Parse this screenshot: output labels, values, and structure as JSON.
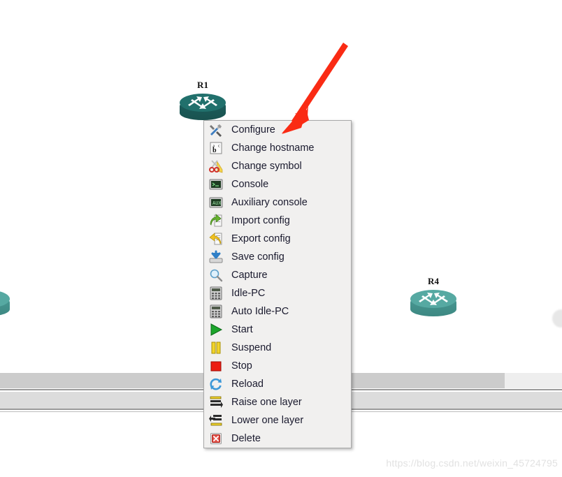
{
  "canvas": {
    "background_color": "#ffffff",
    "nodes": [
      {
        "id": "r1",
        "label": "R1",
        "style": "dark",
        "color": "#21706c"
      },
      {
        "id": "r4",
        "label": "R4",
        "style": "light",
        "color": "#56a9a2"
      },
      {
        "id": "partial-left",
        "label": "",
        "style": "dark",
        "color": "#3d8882"
      }
    ]
  },
  "context_menu": {
    "target_node": "R1",
    "background_color": "#f1f0ef",
    "border_color": "#a8a8a8",
    "items": [
      {
        "label": "Configure",
        "icon": "wrench-screwdriver-icon"
      },
      {
        "label": "Change hostname",
        "icon": "ab-textbox-icon"
      },
      {
        "label": "Change symbol",
        "icon": "scissors-icon"
      },
      {
        "label": "Console",
        "icon": "terminal-icon"
      },
      {
        "label": "Auxiliary console",
        "icon": "aux-terminal-icon"
      },
      {
        "label": "Import config",
        "icon": "green-import-arrow-icon"
      },
      {
        "label": "Export config",
        "icon": "yellow-export-arrow-icon"
      },
      {
        "label": "Save config",
        "icon": "save-disk-icon"
      },
      {
        "label": "Capture",
        "icon": "magnifier-icon"
      },
      {
        "label": "Idle-PC",
        "icon": "calculator-icon"
      },
      {
        "label": "Auto Idle-PC",
        "icon": "calculator-icon"
      },
      {
        "label": "Start",
        "icon": "green-play-icon"
      },
      {
        "label": "Suspend",
        "icon": "yellow-pause-icon"
      },
      {
        "label": "Stop",
        "icon": "red-stop-icon"
      },
      {
        "label": "Reload",
        "icon": "blue-refresh-icon"
      },
      {
        "label": "Raise one layer",
        "icon": "raise-layer-icon"
      },
      {
        "label": "Lower one layer",
        "icon": "lower-layer-icon"
      },
      {
        "label": "Delete",
        "icon": "red-delete-icon"
      }
    ]
  },
  "annotation": {
    "arrow_color": "#fa2b14",
    "points_to": "Configure"
  },
  "watermark": {
    "text": "https://blog.csdn.net/weixin_45724795"
  }
}
